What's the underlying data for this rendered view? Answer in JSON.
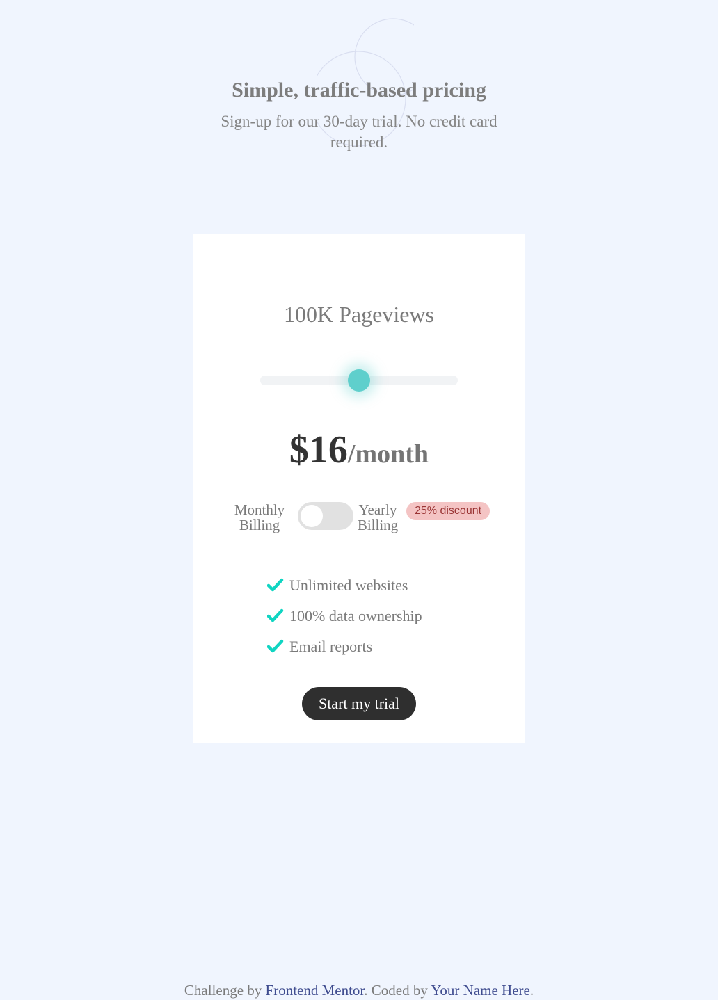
{
  "header": {
    "title": "Simple, traffic-based pricing",
    "subtitle": "Sign-up for our 30-day trial. No credit card required."
  },
  "card": {
    "pageviews": "100K Pageviews",
    "slider": {
      "level": 0.5
    },
    "price": {
      "amount": "$16",
      "period": "/month"
    },
    "billing": {
      "monthly_label": "Monthly Billing",
      "yearly_label": "Yearly Billing",
      "discount": "25% discount",
      "yearly_selected": false
    },
    "features": [
      {
        "text": "Unlimited websites",
        "icon": "check-icon"
      },
      {
        "text": "100% data ownership",
        "icon": "check-icon"
      },
      {
        "text": "Email reports",
        "icon": "check-icon"
      }
    ],
    "cta_label": "Start my trial"
  },
  "footer": {
    "prefix": "Challenge by",
    "link1": "Frontend Mentor",
    "middle": ". Coded by",
    "link2": "Your Name Here",
    "suffix": "."
  },
  "colors": {
    "background": "#f0f5fe",
    "accent": "#5fcfcc",
    "check": "#10d5c2",
    "discount_bg": "#f4c4c4",
    "button": "#2f2f2f"
  }
}
